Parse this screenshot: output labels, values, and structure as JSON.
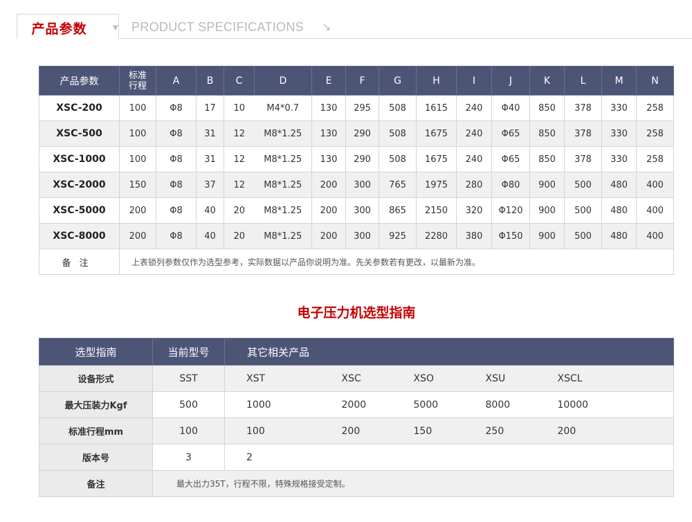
{
  "header": {
    "title": "产品参数",
    "subtitle": "PRODUCT SPECIFICATIONS",
    "arrow_icon": "↘"
  },
  "spec_table": {
    "headers": [
      "产品参数",
      "标准\n行程",
      "A",
      "B",
      "C",
      "D",
      "E",
      "F",
      "G",
      "H",
      "I",
      "J",
      "K",
      "L",
      "M",
      "N"
    ],
    "rows": [
      {
        "model": "XSC-200",
        "cells": [
          "100",
          "Φ8",
          "17",
          "10",
          "M4*0.7",
          "130",
          "295",
          "508",
          "1615",
          "240",
          "Φ40",
          "850",
          "378",
          "330",
          "258"
        ]
      },
      {
        "model": "XSC-500",
        "cells": [
          "100",
          "Φ8",
          "31",
          "12",
          "M8*1.25",
          "130",
          "290",
          "508",
          "1675",
          "240",
          "Φ65",
          "850",
          "378",
          "330",
          "258"
        ]
      },
      {
        "model": "XSC-1000",
        "cells": [
          "100",
          "Φ8",
          "31",
          "12",
          "M8*1.25",
          "130",
          "290",
          "508",
          "1675",
          "240",
          "Φ65",
          "850",
          "378",
          "330",
          "258"
        ]
      },
      {
        "model": "XSC-2000",
        "cells": [
          "150",
          "Φ8",
          "37",
          "12",
          "M8*1.25",
          "200",
          "300",
          "765",
          "1975",
          "280",
          "Φ80",
          "900",
          "500",
          "480",
          "400"
        ]
      },
      {
        "model": "XSC-5000",
        "cells": [
          "200",
          "Φ8",
          "40",
          "20",
          "M8*1.25",
          "200",
          "300",
          "865",
          "2150",
          "320",
          "Φ120",
          "900",
          "500",
          "480",
          "400"
        ]
      },
      {
        "model": "XSC-8000",
        "cells": [
          "200",
          "Φ8",
          "40",
          "20",
          "M8*1.25",
          "200",
          "300",
          "925",
          "2280",
          "380",
          "Φ150",
          "900",
          "500",
          "480",
          "400"
        ]
      }
    ],
    "note_label": "备注",
    "note_text": "上表锁列参数仅作为选型参考，实际数据以产品你说明为准。先关参数若有更改，以最新为准。"
  },
  "guide_title": "电子压力机选型指南",
  "guide_table": {
    "headers": [
      "选型指南",
      "当前型号",
      "其它相关产品"
    ],
    "rows": [
      {
        "label": "设备形式",
        "current": "SST",
        "others": [
          "XST",
          "XSC",
          "XSO",
          "XSU",
          "XSCL"
        ]
      },
      {
        "label": "最大压装力Kgf",
        "current": "500",
        "others": [
          "1000",
          "2000",
          "5000",
          "8000",
          "10000"
        ]
      },
      {
        "label": "标准行程mm",
        "current": "100",
        "others": [
          "100",
          "200",
          "150",
          "250",
          "200"
        ]
      },
      {
        "label": "版本号",
        "current": "3",
        "others": [
          "2",
          "",
          "",
          "",
          ""
        ]
      }
    ],
    "note_label": "备注",
    "note_text": "最大出力35T，行程不限，特殊规格接受定制。"
  },
  "colors": {
    "accent_red": "#c40000",
    "header_bg": "#4d5577",
    "row_alt": "#f0f0f0"
  }
}
